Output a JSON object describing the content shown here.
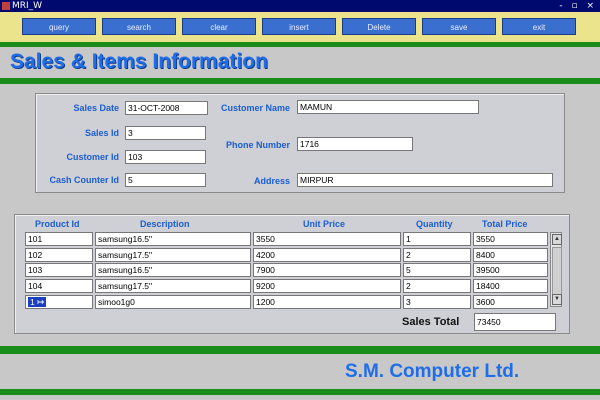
{
  "titlebar": {
    "title": "MRI_W",
    "controls": "- ▫ ×"
  },
  "toolbar": {
    "buttons": [
      "query",
      "search",
      "clear",
      "insert",
      "Delete",
      "save",
      "exit"
    ]
  },
  "heading": "Sales & Items Information",
  "sales_form": {
    "sales_date_label": "Sales Date",
    "sales_date": "31-OCT-2008",
    "sales_id_label": "Sales Id",
    "sales_id": "3",
    "customer_id_label": "Customer Id",
    "customer_id": "103",
    "cash_counter_label": "Cash Counter Id",
    "cash_counter_id": "5",
    "customer_name_label": "Customer Name",
    "customer_name": "MAMUN",
    "phone_label": "Phone Number",
    "phone": "1716",
    "address_label": "Address",
    "address": "MIRPUR"
  },
  "items": {
    "headers": [
      "Product Id",
      "Description",
      "Unit Price",
      "Quantity",
      "Total Price"
    ],
    "rows": [
      [
        "101",
        "samsung16.5\"",
        "3550",
        "1",
        "3550"
      ],
      [
        "102",
        "samsung17.5\"",
        "4200",
        "2",
        "8400"
      ],
      [
        "103",
        "samsung16.5\"",
        "7900",
        "5",
        "39500"
      ],
      [
        "104",
        "samsung17.5\"",
        "9200",
        "2",
        "18400"
      ],
      [
        "1 ↦",
        "simoo1g0",
        "1200",
        "3",
        "3600"
      ]
    ],
    "sales_total_label": "Sales Total",
    "sales_total": "73450"
  },
  "footer": {
    "company": "S.M. Computer Ltd."
  }
}
